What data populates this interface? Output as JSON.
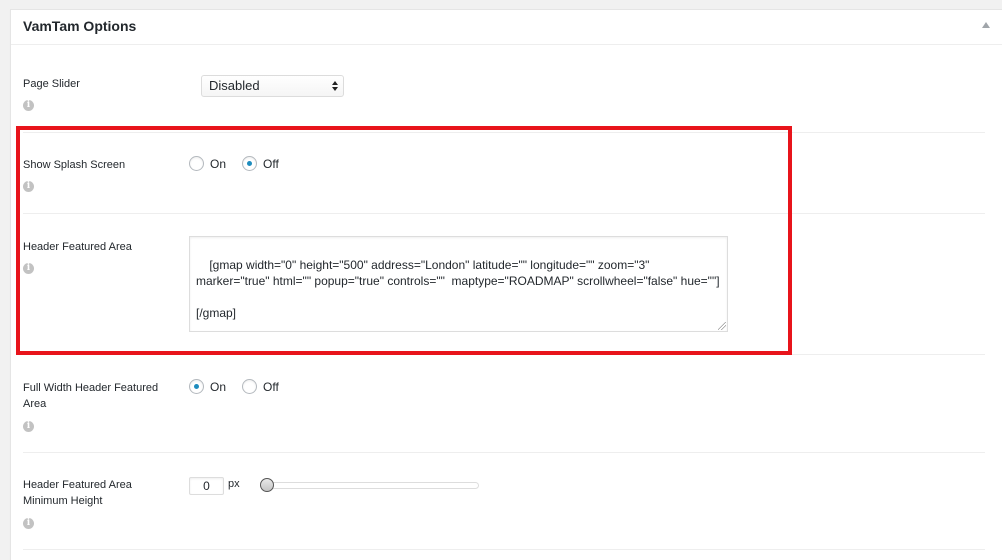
{
  "panel": {
    "title": "VamTam Options"
  },
  "page_slider": {
    "label": "Page Slider",
    "info_icon": "info-icon",
    "selected": "Disabled"
  },
  "splash_screen": {
    "label": "Show Splash Screen",
    "info_icon": "info-icon",
    "on_label": "On",
    "off_label": "Off",
    "selected": "Off"
  },
  "header_featured_area": {
    "label": "Header Featured Area",
    "info_icon": "info-icon",
    "value": "[gmap width=\"0\" height=\"500\" address=\"London\" latitude=\"\" longitude=\"\" zoom=\"3\" marker=\"true\" html=\"\" popup=\"true\" controls=\"\"  maptype=\"ROADMAP\" scrollwheel=\"false\" hue=\"\"]\n\n[/gmap]"
  },
  "full_width_header": {
    "label": "Full Width Header Featured Area",
    "info_icon": "info-icon",
    "on_label": "On",
    "off_label": "Off",
    "selected": "On"
  },
  "header_min_height": {
    "label": "Header Featured Area Minimum Height",
    "info_icon": "info-icon",
    "value": "0",
    "unit": "px",
    "slider_level": 0
  },
  "colors": {
    "highlight": "#e8141b",
    "radio_checked": "#1e8cbe"
  }
}
